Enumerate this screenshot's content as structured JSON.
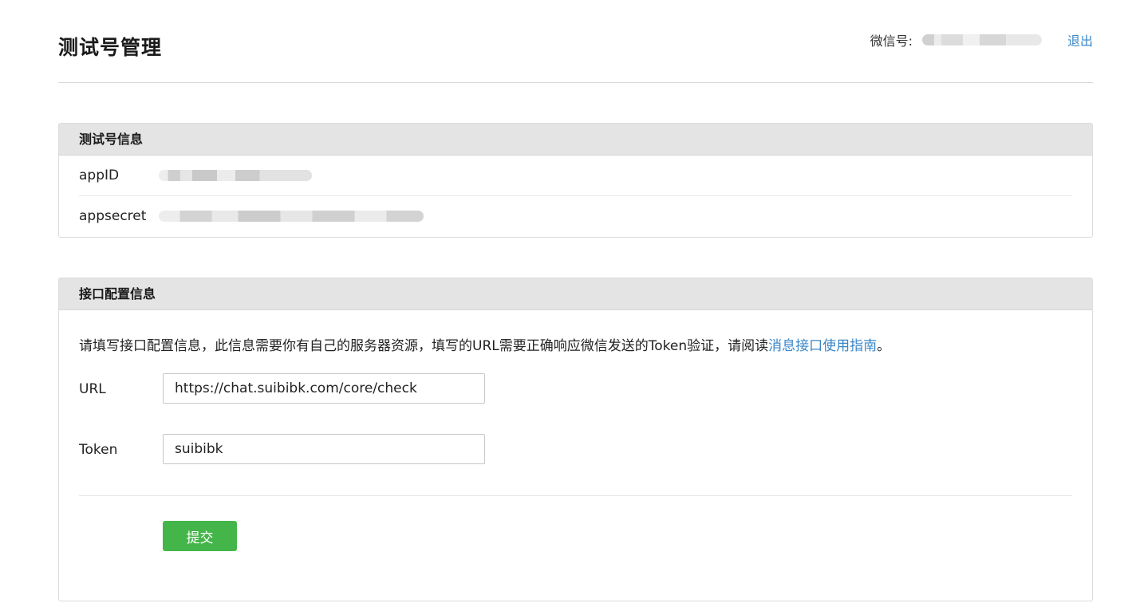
{
  "header": {
    "title": "测试号管理",
    "account_label": "微信号:",
    "logout_label": "退出"
  },
  "info_panel": {
    "title": "测试号信息",
    "rows": [
      {
        "key": "appID"
      },
      {
        "key": "appsecret"
      }
    ]
  },
  "config_panel": {
    "title": "接口配置信息",
    "description": "请填写接口配置信息，此信息需要你有自己的服务器资源，填写的URL需要正确响应微信发送的Token验证，请阅读",
    "guide_link": "消息接口使用指南",
    "description_end": "。",
    "url_label": "URL",
    "url_value": "https://chat.suibibk.com/core/check",
    "token_label": "Token",
    "token_value": "suibibk",
    "submit_label": "提交"
  },
  "colors": {
    "accent_link": "#3a87c8",
    "submit_green": "#44b549",
    "panel_header_bg": "#e4e4e4"
  }
}
